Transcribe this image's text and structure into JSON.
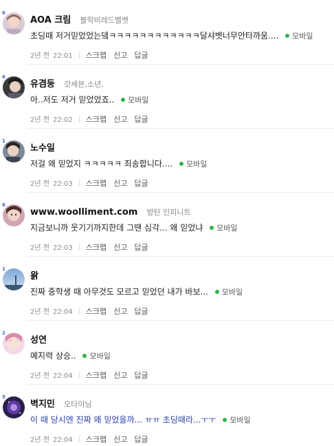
{
  "comments": [
    {
      "level": "6",
      "nickname": "AOA 크림",
      "grade": "블락비레드벨벳",
      "text": "초딩때 저거믿었었는뎈ㅋㅋㅋㅋㅋㅋㅋㅋㅋㅋㅋㅋ달샤벳너무안타까움....",
      "mobile": "모바일",
      "date": "2년 전",
      "time": "22:01",
      "actions": [
        "스크랩",
        "신고",
        "답글"
      ]
    },
    {
      "level": "6",
      "nickname": "유겸둥",
      "grade": "갓세븐,소년,",
      "text": "아..저도 저거 믿었었죠..",
      "mobile": "모바일",
      "date": "2년 전",
      "time": "22:02",
      "actions": [
        "스크랩",
        "신고",
        "답글"
      ]
    },
    {
      "level": "1",
      "nickname": "노수일",
      "grade": "",
      "text": "저걸 왜 믿었지 ㅋㅋㅋㅋㅋ 죄송합니다....",
      "mobile": "모바일",
      "date": "2년 전",
      "time": "22:03",
      "actions": [
        "스크랩",
        "신고",
        "답글"
      ]
    },
    {
      "level": "6",
      "nickname": "www.woolliment.com",
      "grade": "방탄 인피니트",
      "text": "지금보니까 웃기기까지한데 그땐 심각... 왜 믿었냐",
      "mobile": "모바일",
      "date": "2년 전",
      "time": "22:03",
      "actions": [
        "스크랩",
        "신고",
        "답글"
      ]
    },
    {
      "level": "1",
      "nickname": "왉",
      "grade": "",
      "text": "진짜 중학생 때 아무것도 모르고 믿었던 내가 바보...",
      "mobile": "모바일",
      "date": "2년 전",
      "time": "22:04",
      "actions": [
        "스크랩",
        "신고",
        "답글"
      ]
    },
    {
      "level": "2",
      "nickname": "성연",
      "grade": "",
      "text": "예지력 상승..",
      "mobile": "모바일",
      "date": "2년 전",
      "time": "22:04",
      "actions": [
        "스크랩",
        "신고",
        "답글"
      ]
    },
    {
      "level": "5",
      "nickname": "벽지민",
      "grade": "오타이님",
      "text": "이 때 당시엔 진짜 왜 믿었을까... ㅠㅠ 초딩때라...ㅜㅜ",
      "mobile": "모바일",
      "date": "2년 전",
      "time": "22:04",
      "actions": [
        "스크랩",
        "신고",
        "답글"
      ]
    }
  ]
}
